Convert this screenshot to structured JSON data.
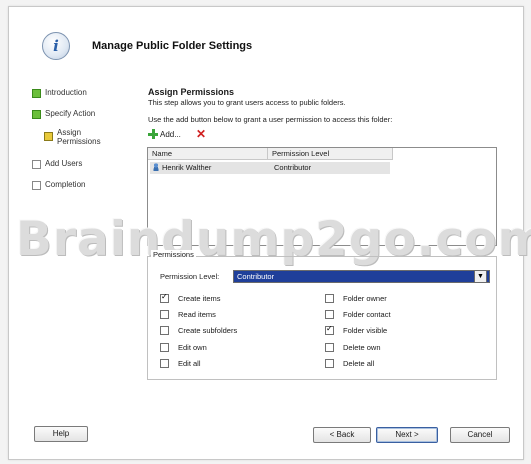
{
  "window": {
    "title": "Manage Public Folder Settings"
  },
  "nav": {
    "items": [
      {
        "label": "Introduction",
        "state": "done"
      },
      {
        "label": "Specify Action",
        "state": "done"
      },
      {
        "label": "Assign\nPermissions",
        "state": "current"
      },
      {
        "label": "Add Users",
        "state": "todo"
      },
      {
        "label": "Completion",
        "state": "todo"
      }
    ]
  },
  "main": {
    "section_title": "Assign Permissions",
    "description": "This step allows you to grant users access to public folders.",
    "instruction": "Use the add button below to grant a user permission to access this folder:",
    "add_label": "Add...",
    "list": {
      "columns": [
        "Name",
        "Permission Level"
      ],
      "rows": [
        {
          "name": "Henrik Walther",
          "level": "Contributor"
        }
      ]
    },
    "permissions": {
      "group_label": "Permissions",
      "level_label": "Permission Level:",
      "level_value": "Contributor",
      "checkboxes": [
        {
          "label": "Create items",
          "checked": true
        },
        {
          "label": "Folder owner",
          "checked": false
        },
        {
          "label": "Read items",
          "checked": false
        },
        {
          "label": "Folder contact",
          "checked": false
        },
        {
          "label": "Create subfolders",
          "checked": false
        },
        {
          "label": "Folder visible",
          "checked": true
        },
        {
          "label": "Edit own",
          "checked": false
        },
        {
          "label": "Delete own",
          "checked": false
        },
        {
          "label": "Edit all",
          "checked": false
        },
        {
          "label": "Delete all",
          "checked": false
        }
      ]
    }
  },
  "watermark": "Braindump2go.com",
  "footer": {
    "help": "Help",
    "back": "< Back",
    "next": "Next >",
    "cancel": "Cancel"
  }
}
